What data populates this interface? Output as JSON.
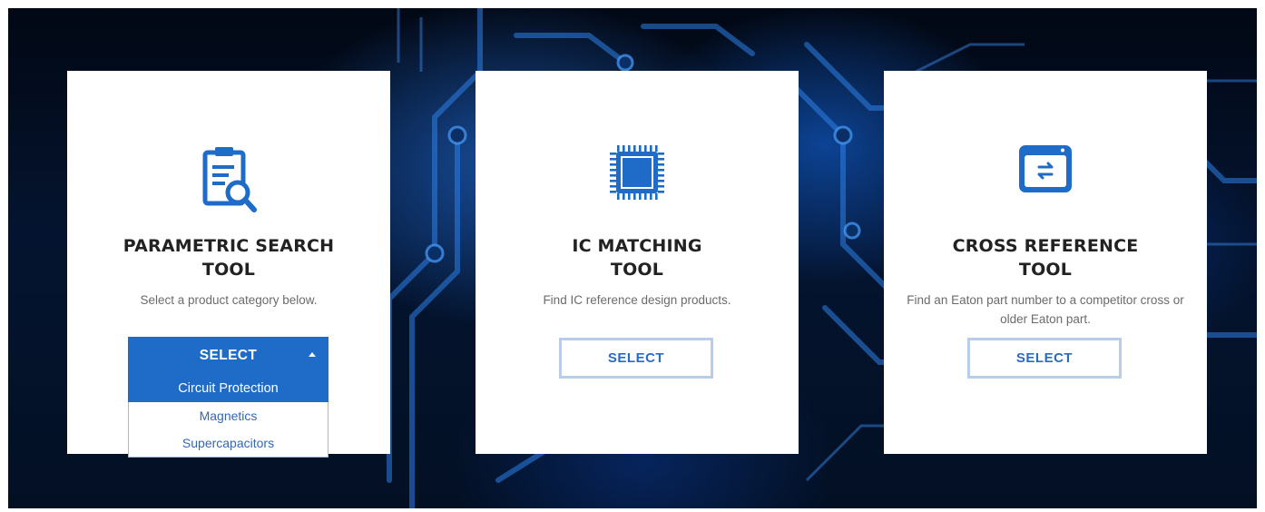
{
  "colors": {
    "accent": "#1f6bc8",
    "outline": "#b7cde9",
    "heading": "#222222",
    "body_text": "#6b6b6b"
  },
  "cards": [
    {
      "icon": "clipboard-search-icon",
      "title": "PARAMETRIC SEARCH\nTOOL",
      "description": "Select a product category below.",
      "select_label": "SELECT",
      "dropdown": {
        "open": true,
        "options": [
          "Circuit Protection",
          "Magnetics",
          "Supercapacitors"
        ],
        "highlighted": "Circuit Protection"
      }
    },
    {
      "icon": "chip-icon",
      "title": "IC MATCHING\nTOOL",
      "description": "Find IC reference design products.",
      "select_label": "SELECT"
    },
    {
      "icon": "window-swap-icon",
      "title": "CROSS REFERENCE\nTOOL",
      "description": "Find an Eaton part number to a competitor cross or older Eaton part.",
      "select_label": "SELECT"
    }
  ]
}
